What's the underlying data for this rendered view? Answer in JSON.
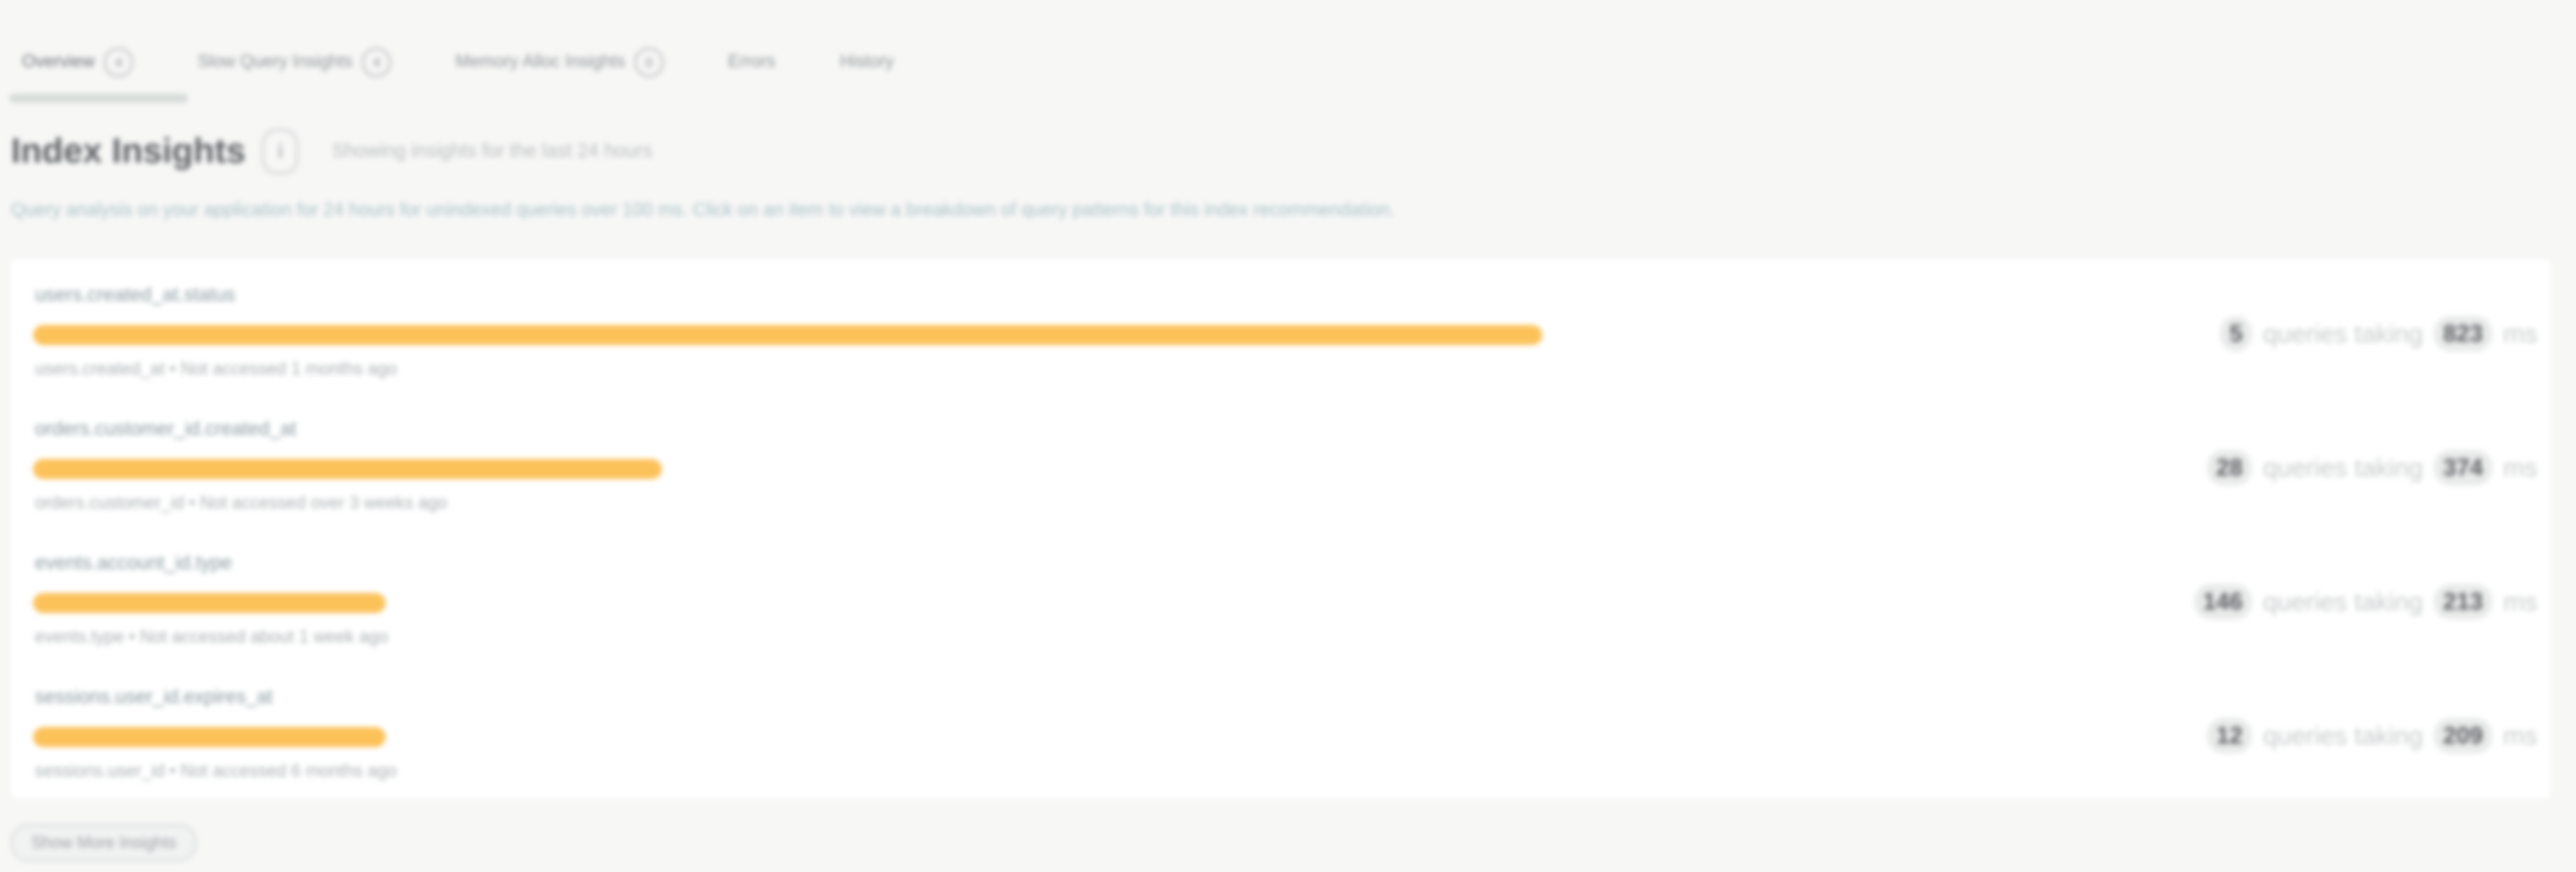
{
  "tabs": [
    {
      "label": "Overview",
      "count": "4"
    },
    {
      "label": "Slow Query Insights",
      "count": "4"
    },
    {
      "label": "Memory Alloc Insights",
      "count": "0"
    },
    {
      "label": "Errors"
    },
    {
      "label": "History"
    }
  ],
  "header": {
    "title": "Index Insights",
    "info_icon": "info-icon",
    "meta": "Showing insights for the last 24 hours"
  },
  "description": "Query analysis on your application for 24 hours for unindexed queries over 100 ms. Click on an item to view a breakdown of query patterns for this index recommendation.",
  "rows": [
    {
      "name": "users.created_at.status",
      "meta": "users.created_at • Not accessed 1 months ago",
      "bar_fraction": 0.6,
      "queries": "5",
      "queries_suffix": "queries taking",
      "duration": "823",
      "duration_unit": "ms"
    },
    {
      "name": "orders.customer_id.created_at",
      "meta": "orders.customer_id • Not accessed over 3 weeks ago",
      "bar_fraction": 0.25,
      "queries": "28",
      "queries_suffix": "queries taking",
      "duration": "374",
      "duration_unit": "ms"
    },
    {
      "name": "events.account_id.type",
      "meta": "events.type • Not accessed about 1 week ago",
      "bar_fraction": 0.14,
      "queries": "146",
      "queries_suffix": "queries taking",
      "duration": "213",
      "duration_unit": "ms"
    },
    {
      "name": "sessions.user_id.expires_at",
      "meta": "sessions.user_id • Not accessed 6 months ago",
      "bar_fraction": 0.14,
      "queries": "12",
      "queries_suffix": "queries taking",
      "duration": "209",
      "duration_unit": "ms"
    }
  ],
  "show_more_label": "Show More Insights",
  "colors": {
    "bar": "#fcc25a",
    "background": "#f7f7f6",
    "card": "#ffffff"
  }
}
